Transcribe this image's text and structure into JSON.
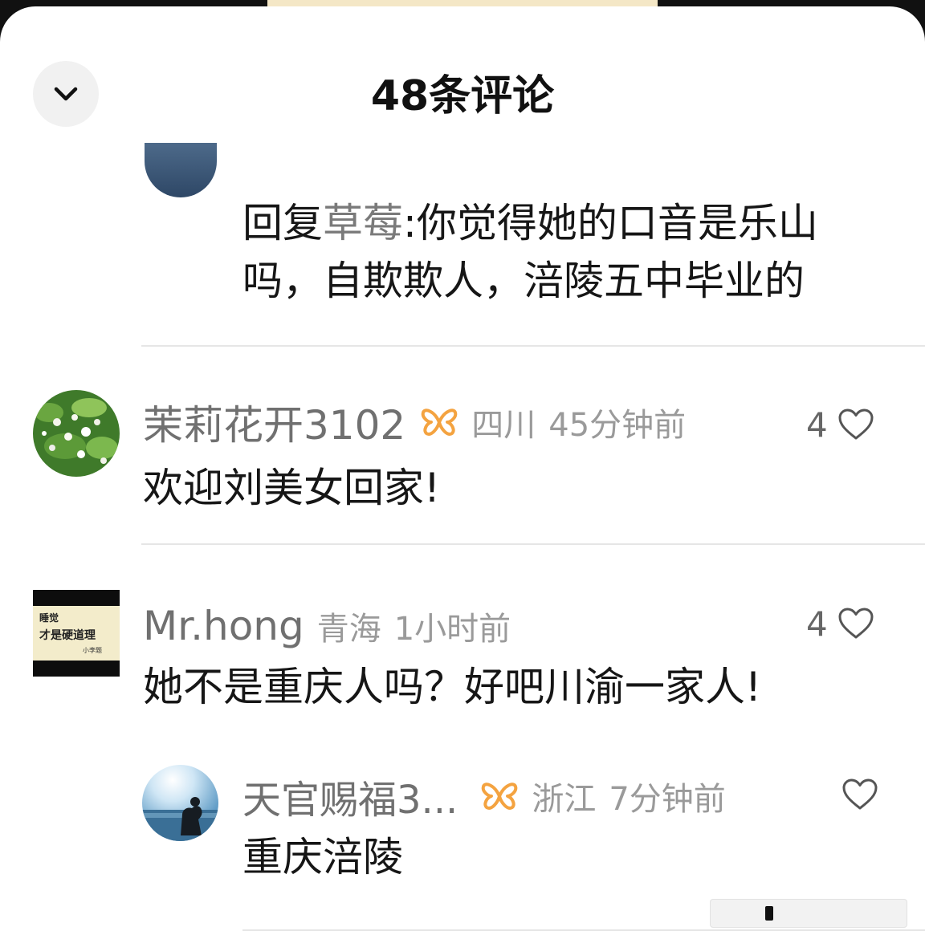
{
  "header": {
    "title": "48条评论"
  },
  "reply_top": {
    "prefix": "回复",
    "mention": "草莓",
    "text": ":你觉得她的口音是乐山吗，自欺欺人，涪陵五中毕业的"
  },
  "comments": [
    {
      "username": "茉莉花开3102",
      "region": "四川",
      "time": "45分钟前",
      "likes": "4",
      "text": "欢迎刘美女回家!"
    },
    {
      "username": "Mr.hong",
      "region": "青海",
      "time": "1小时前",
      "likes": "4",
      "text": "她不是重庆人吗？好吧川渝一家人!"
    }
  ],
  "sub_reply": {
    "username": "天官赐福3...",
    "region": "浙江",
    "time": "7分钟前",
    "text": "重庆涪陵"
  },
  "avatar_mrhong_text": [
    "睡觉",
    "才是硬道理",
    "小李题"
  ],
  "colors": {
    "badge": "#f4a340",
    "username": "#707070",
    "meta": "#9a9a9a",
    "text": "#161616"
  },
  "icons": [
    "chevron-down-icon",
    "heart-outline-icon",
    "butterfly-badge-icon"
  ]
}
